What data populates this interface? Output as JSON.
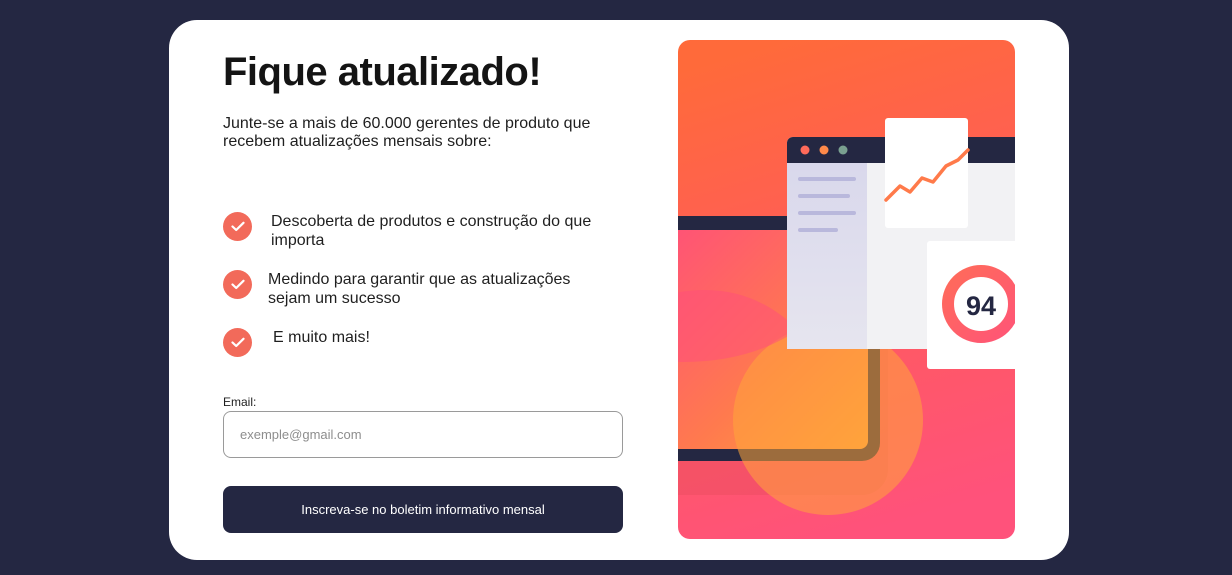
{
  "signup": {
    "title": "Fique atualizado!",
    "intro": "Junte-se a mais de 60.000 gerentes de produto que recebem atualizações mensais sobre:",
    "features": [
      "Descoberta de produtos e construção do que importa",
      "Medindo para garantir que as atualizações sejam um sucesso",
      "E muito mais!"
    ],
    "email_label": "Email:",
    "email_placeholder": "exemple@gmail.com",
    "email_value": "",
    "submit_label": "Inscreva-se no boletim informativo mensal"
  },
  "illustration": {
    "score": "94",
    "icon": "dashboard-illustration"
  },
  "colors": {
    "page_background": "#242742",
    "card_background": "#ffffff",
    "accent": "#f26a5a",
    "button_background": "#242742",
    "gradient_top": "#ff6a3a",
    "gradient_bottom": "#ff527b"
  }
}
